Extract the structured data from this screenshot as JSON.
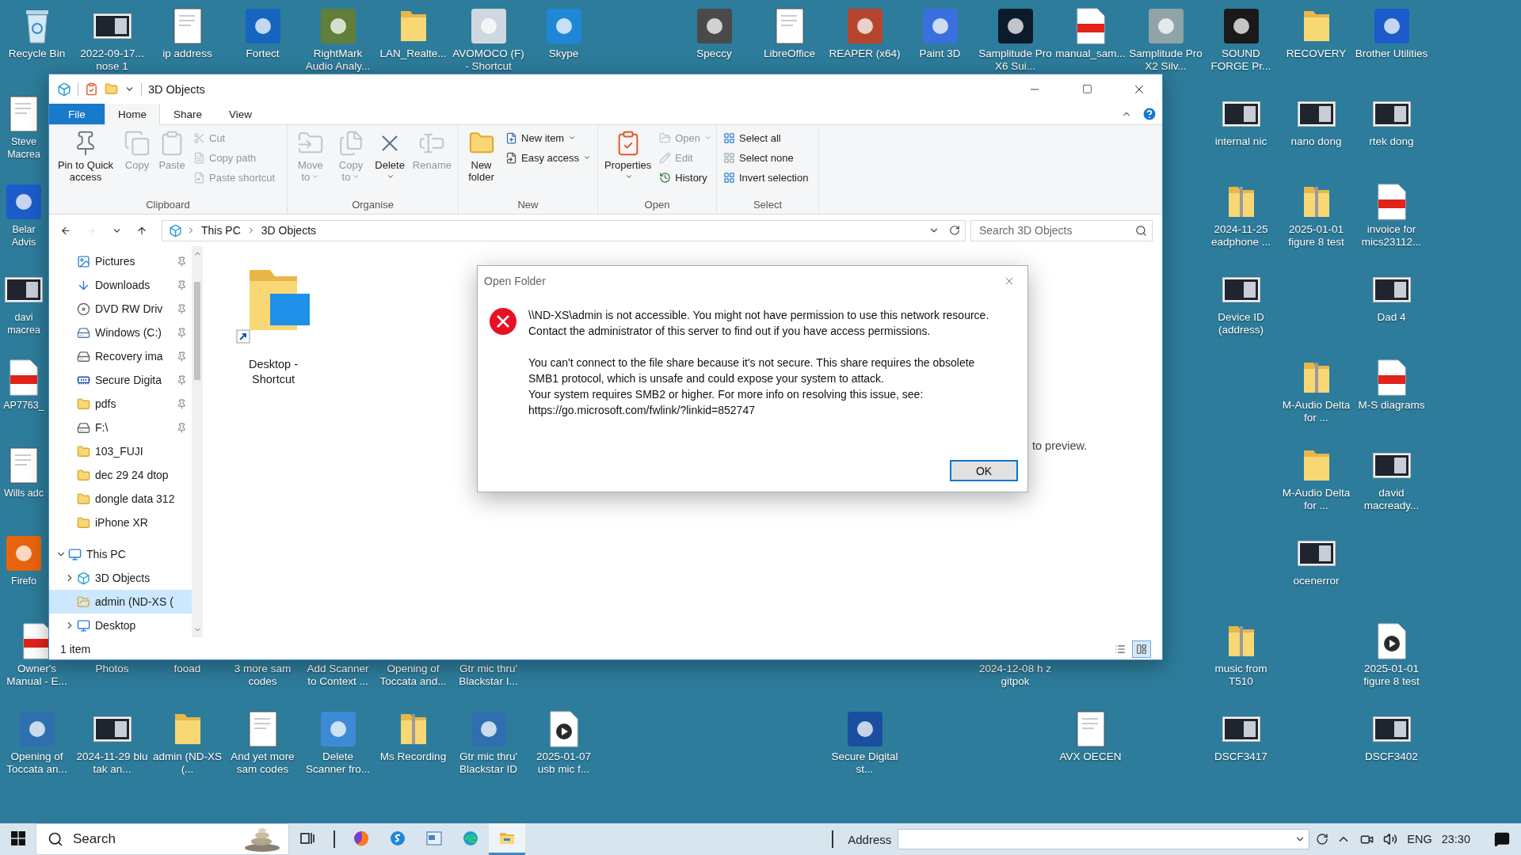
{
  "desktop_icons": [
    {
      "label": "Recycle Bin",
      "kind": "recycle"
    },
    {
      "label": "2022-09-17... nose 1",
      "kind": "image"
    },
    {
      "label": "ip address",
      "kind": "doc"
    },
    {
      "label": "Fortect",
      "kind": "app",
      "color": "#1565c0"
    },
    {
      "label": "RightMark Audio Analy...",
      "kind": "app",
      "color": "#5f7f3a"
    },
    {
      "label": "LAN_Realte...",
      "kind": "folder"
    },
    {
      "label": "AVOMOCO (F) - Shortcut",
      "kind": "app",
      "color": "#cfd8e0"
    },
    {
      "label": "Skype",
      "kind": "app",
      "color": "#1e88d6"
    },
    {
      "label": "Speccy",
      "kind": "app",
      "color": "#4a4a4a"
    },
    {
      "label": "LibreOffice",
      "kind": "doc"
    },
    {
      "label": "REAPER (x64)",
      "kind": "app",
      "color": "#b5452c"
    },
    {
      "label": "Paint 3D",
      "kind": "app",
      "color": "#3b6fe0"
    },
    {
      "label": "Samplitude Pro X6 Sui...",
      "kind": "app",
      "color": "#0b1b2b"
    },
    {
      "label": "manual_sam...",
      "kind": "pdf"
    },
    {
      "label": "Samplitude Pro X2 Silv...",
      "kind": "app",
      "color": "#8fa3a8"
    },
    {
      "label": "SOUND FORGE Pr...",
      "kind": "app",
      "color": "#1a1a1a"
    },
    {
      "label": "RECOVERY",
      "kind": "folder"
    },
    {
      "label": "Brother Utilities",
      "kind": "app",
      "color": "#1c5bc9"
    },
    {
      "label": "Steve Macrea",
      "kind": "doc"
    },
    {
      "label": "internal nic",
      "kind": "image"
    },
    {
      "label": "nano dong",
      "kind": "image"
    },
    {
      "label": "rtek dong",
      "kind": "image"
    },
    {
      "label": "Belar Advis",
      "kind": "app",
      "color": "#1c5bc9"
    },
    {
      "label": "2024-11-25 eadphone ...",
      "kind": "zip"
    },
    {
      "label": "2025-01-01 figure 8 test",
      "kind": "zip"
    },
    {
      "label": "invoice for mics23112...",
      "kind": "pdf"
    },
    {
      "label": "davi macrea",
      "kind": "image"
    },
    {
      "label": "Device ID (address)",
      "kind": "image"
    },
    {
      "label": "Dad 4",
      "kind": "image"
    },
    {
      "label": "AP7763_",
      "kind": "pdf"
    },
    {
      "label": "M-Audio Delta for ...",
      "kind": "zip"
    },
    {
      "label": "M-S diagrams",
      "kind": "pdf"
    },
    {
      "label": "Wills adc",
      "kind": "doc"
    },
    {
      "label": "M-Audio Delta for ...",
      "kind": "folder"
    },
    {
      "label": "david macready...",
      "kind": "image"
    },
    {
      "label": "Firefo",
      "kind": "app",
      "color": "#e8640c"
    },
    {
      "label": "ocenerror",
      "kind": "image"
    },
    {
      "label": "Owner's Manual - E...",
      "kind": "pdf"
    },
    {
      "label": "Photos",
      "kind": "none"
    },
    {
      "label": "fooad",
      "kind": "none"
    },
    {
      "label": "3 more sam codes",
      "kind": "none"
    },
    {
      "label": "Add Scanner to Context ...",
      "kind": "none"
    },
    {
      "label": "Opening of Toccata and...",
      "kind": "none"
    },
    {
      "label": "Gtr mic thru' Blackstar I...",
      "kind": "none"
    },
    {
      "label": "2024-12-08 h z gitpok",
      "kind": "none"
    },
    {
      "label": "music from T510",
      "kind": "zip"
    },
    {
      "label": "2025-01-01 figure 8 test",
      "kind": "video"
    },
    {
      "label": "Opening of Toccata an...",
      "kind": "app",
      "color": "#2f6fb0"
    },
    {
      "label": "2024-11-29 blu tak an...",
      "kind": "image"
    },
    {
      "label": "admin (ND-XS (...",
      "kind": "folder"
    },
    {
      "label": "And yet more sam codes",
      "kind": "doc"
    },
    {
      "label": "Delete Scanner fro...",
      "kind": "app",
      "color": "#3d8ad6"
    },
    {
      "label": "Ms Recording",
      "kind": "zip"
    },
    {
      "label": "Gtr mic thru' Blackstar ID",
      "kind": "app",
      "color": "#2f6fb0"
    },
    {
      "label": "2025-01-07 usb mic f...",
      "kind": "video"
    },
    {
      "label": "Secure Digital st...",
      "kind": "app",
      "color": "#1a4fa0"
    },
    {
      "label": "AVX OECEN",
      "kind": "doc"
    },
    {
      "label": "DSCF3417",
      "kind": "image"
    },
    {
      "label": "DSCF3402",
      "kind": "image"
    }
  ],
  "explorer": {
    "title": "3D Objects",
    "ribbon_tabs": [
      {
        "label": "File",
        "kind": "file",
        "selected": false
      },
      {
        "label": "Home",
        "kind": "tab",
        "selected": true
      },
      {
        "label": "Share",
        "kind": "tab",
        "selected": false
      },
      {
        "label": "View",
        "kind": "tab",
        "selected": false
      }
    ],
    "ribbon_groups": [
      {
        "label": "Clipboard",
        "large": [
          {
            "label": "Pin to Quick access",
            "disabled": false,
            "dropdown": false
          },
          {
            "label": "Copy",
            "disabled": true,
            "dropdown": false
          },
          {
            "label": "Paste",
            "disabled": true,
            "dropdown": false
          }
        ],
        "small": [
          {
            "label": "Cut",
            "disabled": true,
            "dropdown": false
          },
          {
            "label": "Copy path",
            "disabled": true,
            "dropdown": false
          },
          {
            "label": "Paste shortcut",
            "disabled": true,
            "dropdown": false
          }
        ]
      },
      {
        "label": "Organise",
        "large": [
          {
            "label": "Move to",
            "disabled": true,
            "dropdown": true
          },
          {
            "label": "Copy to",
            "disabled": true,
            "dropdown": true
          },
          {
            "label": "Delete",
            "disabled": false,
            "dropdown": true
          },
          {
            "label": "Rename",
            "disabled": true,
            "dropdown": false
          }
        ]
      },
      {
        "label": "New",
        "large": [
          {
            "label": "New folder",
            "disabled": false,
            "dropdown": false
          }
        ],
        "small": [
          {
            "label": "New item",
            "disabled": false,
            "dropdown": true
          },
          {
            "label": "Easy access",
            "disabled": false,
            "dropdown": true
          }
        ]
      },
      {
        "label": "Open",
        "large": [
          {
            "label": "Properties",
            "disabled": false,
            "dropdown": true
          }
        ],
        "small": [
          {
            "label": "Open",
            "disabled": true,
            "dropdown": true
          },
          {
            "label": "Edit",
            "disabled": true,
            "dropdown": false
          },
          {
            "label": "History",
            "disabled": false,
            "dropdown": false
          }
        ]
      },
      {
        "label": "Select",
        "small": [
          {
            "label": "Select all",
            "disabled": false,
            "dropdown": false
          },
          {
            "label": "Select none",
            "disabled": false,
            "dropdown": false
          },
          {
            "label": "Invert selection",
            "disabled": false,
            "dropdown": false
          }
        ]
      }
    ],
    "nav_buttons": [
      {
        "disabled": false
      },
      {
        "disabled": true
      },
      {
        "disabled": false
      },
      {
        "disabled": false
      }
    ],
    "breadcrumbs": [
      "This PC",
      "3D Objects"
    ],
    "search": {
      "placeholder": "Search 3D Objects"
    },
    "quick_access": [
      {
        "label": "Pictures",
        "pinned": true,
        "selected": false
      },
      {
        "label": "Downloads",
        "pinned": true,
        "selected": false
      },
      {
        "label": "DVD RW Driv",
        "pinned": true,
        "selected": false
      },
      {
        "label": "Windows (C:)",
        "pinned": true,
        "selected": false
      },
      {
        "label": "Recovery ima",
        "pinned": true,
        "selected": false
      },
      {
        "label": "Secure Digita",
        "pinned": true,
        "selected": false
      },
      {
        "label": "pdfs",
        "pinned": true,
        "selected": false
      },
      {
        "label": "F:\\",
        "pinned": true,
        "selected": false
      },
      {
        "label": "103_FUJI",
        "pinned": false,
        "selected": false
      },
      {
        "label": "dec 29 24 dtop",
        "pinned": false,
        "selected": false
      },
      {
        "label": "dongle data 312",
        "pinned": false,
        "selected": false
      },
      {
        "label": "iPhone XR",
        "pinned": false,
        "selected": false
      }
    ],
    "this_pc": {
      "label": "This PC",
      "expanded": true,
      "selected": false,
      "children": [
        {
          "label": "3D Objects",
          "expanded": false,
          "selected": false
        },
        {
          "label": "admin (ND-XS (",
          "selected": true
        },
        {
          "label": "Desktop",
          "expanded": false,
          "selected": false
        }
      ]
    },
    "items": [
      {
        "label": "Desktop - Shortcut"
      }
    ],
    "preview_message": "to preview.",
    "status": "1 item",
    "views": [
      {
        "selected": false
      },
      {
        "selected": true
      }
    ]
  },
  "dialog": {
    "title": "Open Folder",
    "paragraphs": [
      "\\\\ND-XS\\admin is not accessible. You might not have permission to use this network resource. Contact the administrator of this server to find out if you have access permissions.",
      "You can't connect to the file share because it's not secure. This share requires the obsolete SMB1 protocol, which is unsafe and could expose your system to attack.",
      "Your system requires SMB2 or higher. For more info on resolving this issue, see:"
    ],
    "url": "https://go.microsoft.com/fwlink/?linkid=852747",
    "button": "OK"
  },
  "taskbar": {
    "search": {
      "placeholder": "Search"
    },
    "apps": [
      {
        "active": false
      },
      {
        "active": false
      },
      {
        "active": false
      },
      {
        "active": false
      },
      {
        "active": true
      }
    ],
    "address_label": "Address",
    "language": "ENG",
    "time": "23:30"
  }
}
